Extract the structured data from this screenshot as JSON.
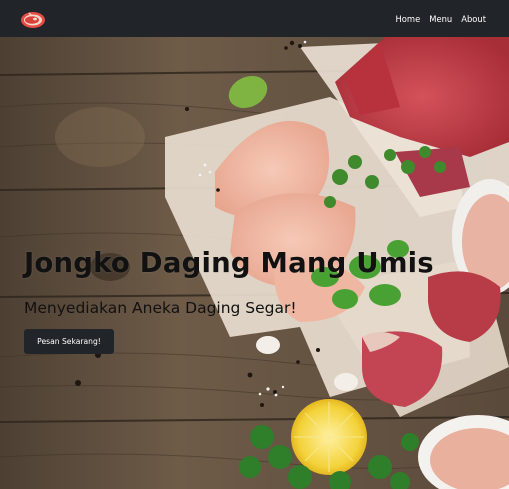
{
  "navbar": {
    "brand_icon": "meat-steak-icon",
    "links": [
      {
        "label": "Home"
      },
      {
        "label": "Menu"
      },
      {
        "label": "About"
      }
    ]
  },
  "hero": {
    "title": "Jongko Daging Mang Umis",
    "subtitle": "Menyediakan Aneka Daging Segar!",
    "cta_label": "Pesan Sekarang!",
    "background_image": "raw meat and chicken on wooden table with herbs and lemon"
  },
  "colors": {
    "navbar_bg": "#212529",
    "button_bg": "#212529",
    "wood": "#6b5845",
    "brand_red": "#d9403a"
  }
}
